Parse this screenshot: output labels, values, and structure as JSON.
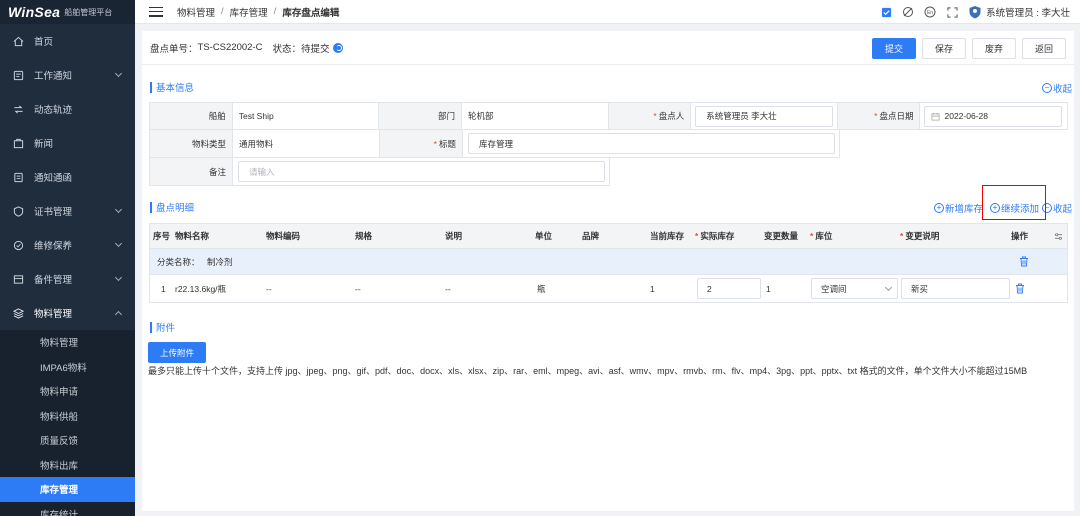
{
  "brand": {
    "name": "WinSea",
    "subtitle": "船舶管理平台"
  },
  "sidebar": {
    "items": [
      {
        "label": "首页",
        "icon": "home-icon"
      },
      {
        "label": "工作通知",
        "icon": "notice-icon",
        "arrow": true
      },
      {
        "label": "动态轨迹",
        "icon": "track-icon"
      },
      {
        "label": "新闻",
        "icon": "news-icon"
      },
      {
        "label": "通知通函",
        "icon": "circular-icon"
      },
      {
        "label": "证书管理",
        "icon": "certificate-icon",
        "arrow": true
      },
      {
        "label": "维修保养",
        "icon": "maintenance-icon",
        "arrow": true
      },
      {
        "label": "备件管理",
        "icon": "spareparts-icon",
        "arrow": true
      },
      {
        "label": "物料管理",
        "icon": "material-icon",
        "arrow": true,
        "open": true
      }
    ],
    "submenu": [
      "物料管理",
      "IMPA6物料",
      "物料申请",
      "物料供船",
      "质量反馈",
      "物料出库",
      "库存管理",
      "库存统计"
    ],
    "active_sub": "库存管理"
  },
  "topbar": {
    "breadcrumb": [
      "物料管理",
      "库存管理",
      "库存盘点编辑"
    ],
    "breadcrumb_sep": "/",
    "user": "系统管理员 : 李大壮",
    "icons": [
      "checkbox-icon",
      "no-location-icon",
      "language-icon",
      "fullscreen-icon"
    ],
    "language_label": "En"
  },
  "doc": {
    "number_label": "盘点单号：",
    "number": "TS-CS22002-C",
    "status_label": "状态：",
    "status": "待提交",
    "buttons": {
      "submit": "提交",
      "save": "保存",
      "discard": "废弃",
      "back": "返回"
    }
  },
  "basic": {
    "title": "基本信息",
    "collapse": "收起",
    "ship_label": "船舶",
    "ship": "Test Ship",
    "dept_label": "部门",
    "dept": "轮机部",
    "counter_label": "盘点人",
    "counter": "系统管理员 李大壮",
    "date_label": "盘点日期",
    "date": "2022-06-28",
    "mtype_label": "物料类型",
    "mtype": "通用物料",
    "title_label": "标题",
    "title_value": "库存管理",
    "remark_label": "备注",
    "remark_placeholder": "请输入"
  },
  "detail": {
    "title": "盘点明细",
    "actions": {
      "add_stock": "新增库存",
      "continue_add": "继续添加",
      "collapse": "收起"
    },
    "columns": {
      "no": "序号",
      "name": "物料名称",
      "code": "物料编码",
      "spec": "规格",
      "desc": "说明",
      "unit": "单位",
      "brand": "品牌",
      "current": "当前库存",
      "actual": "实际库存",
      "change": "变更数量",
      "location": "库位",
      "change_desc": "变更说明",
      "ops": "操作"
    },
    "category_label": "分类名称：",
    "category": "制冷剂",
    "rows": [
      {
        "no": "1",
        "name": "r22.13.6kg/瓶",
        "code": "--",
        "spec": "--",
        "desc": "--",
        "unit": "瓶",
        "brand": "",
        "current": "1",
        "actual": "2",
        "change": "1",
        "location": "空调间",
        "change_desc": "新买"
      }
    ]
  },
  "attach": {
    "title": "附件",
    "upload": "上传附件",
    "hint": "最多只能上传十个文件，支持上传 jpg、jpeg、png、gif、pdf、doc、docx、xls、xlsx、zip、rar、eml、mpeg、avi、asf、wmv、mpv、rmvb、rm、flv、mp4、3pg、ppt、pptx、txt 格式的文件，单个文件大小不能超过15MB"
  },
  "colors": {
    "primary": "#2d7cf6",
    "sidebar": "#1f2d3d",
    "highlight": "#e00000"
  }
}
